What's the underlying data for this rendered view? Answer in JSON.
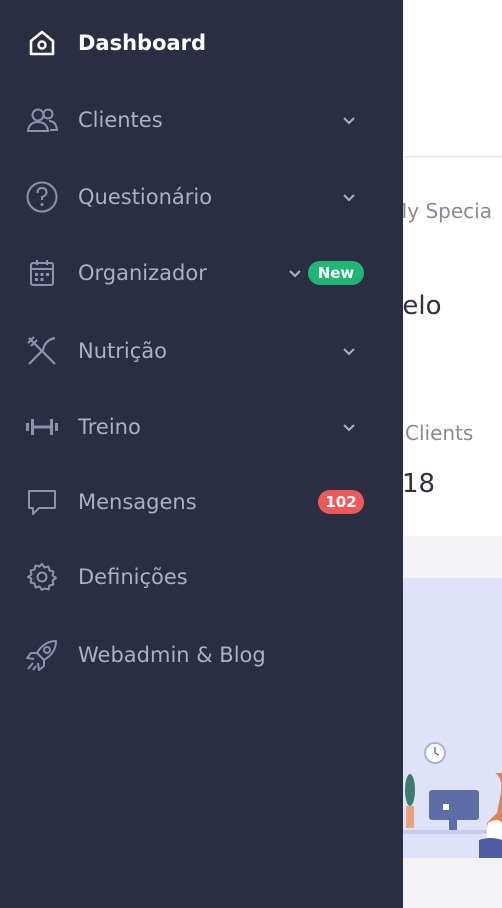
{
  "sidebar": {
    "items": [
      {
        "label": "Dashboard",
        "icon": "home-icon"
      },
      {
        "label": "Clientes",
        "icon": "users-icon"
      },
      {
        "label": "Questionário",
        "icon": "question-icon"
      },
      {
        "label": "Organizador",
        "icon": "calendar-icon",
        "badge": "New"
      },
      {
        "label": "Nutrição",
        "icon": "utensils-icon"
      },
      {
        "label": "Treino",
        "icon": "dumbbell-icon"
      },
      {
        "label": "Mensagens",
        "icon": "message-icon",
        "badge": "102"
      },
      {
        "label": "Definições",
        "icon": "gear-icon"
      },
      {
        "label": "Webadmin & Blog",
        "icon": "rocket-icon"
      }
    ]
  },
  "main": {
    "specialty_label": "My Specia",
    "name_fragment": "rrelo",
    "clients_label": "Clients",
    "clients_count": "18"
  },
  "colors": {
    "sidebar_bg": "#2b2e42",
    "label": "#aab0c8",
    "active_label": "#ffffff",
    "badge_new": "#22b573",
    "badge_count": "#ec5a5a",
    "banner_bg": "#dfe2f8"
  }
}
